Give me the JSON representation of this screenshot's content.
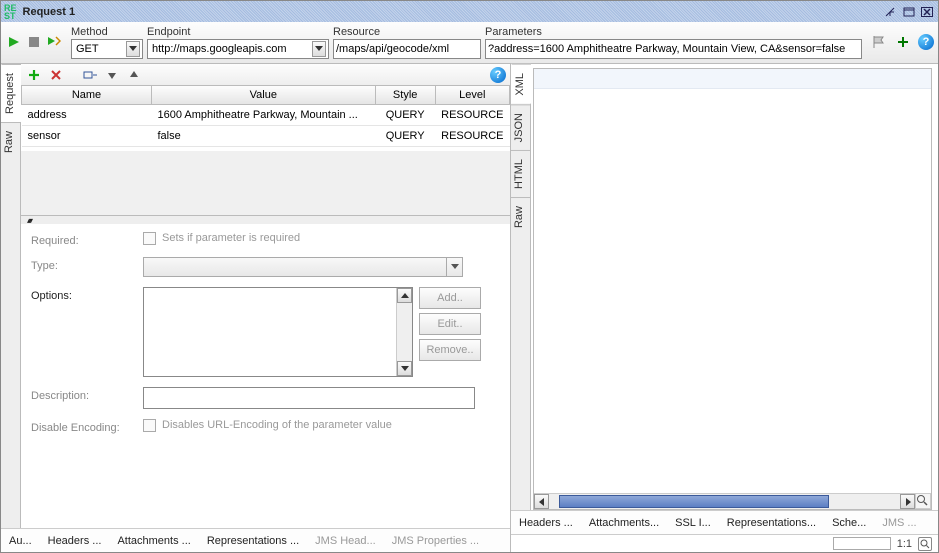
{
  "window": {
    "title": "Request 1"
  },
  "toolbar": {
    "method_label": "Method",
    "method_value": "GET",
    "endpoint_label": "Endpoint",
    "endpoint_value": "http://maps.googleapis.com",
    "resource_label": "Resource",
    "resource_value": "/maps/api/geocode/xml",
    "parameters_label": "Parameters",
    "parameters_value": "?address=1600 Amphitheatre Parkway, Mountain View, CA&sensor=false"
  },
  "left_tabs": {
    "raw": "Raw",
    "request": "Request"
  },
  "params": {
    "headers": {
      "name": "Name",
      "value": "Value",
      "style": "Style",
      "level": "Level"
    },
    "rows": [
      {
        "name": "address",
        "value": "1600 Amphitheatre Parkway, Mountain ...",
        "style": "QUERY",
        "level": "RESOURCE"
      },
      {
        "name": "sensor",
        "value": "false",
        "style": "QUERY",
        "level": "RESOURCE"
      }
    ]
  },
  "form": {
    "required_label": "Required:",
    "required_hint": "Sets if parameter is required",
    "type_label": "Type:",
    "options_label": "Options:",
    "btn_add": "Add..",
    "btn_edit": "Edit..",
    "btn_remove": "Remove..",
    "description_label": "Description:",
    "disable_enc_label": "Disable Encoding:",
    "disable_enc_hint": "Disables URL-Encoding of the parameter value"
  },
  "left_bottom_tabs": {
    "au": "Au...",
    "headers": "Headers ...",
    "attachments": "Attachments ...",
    "representations": "Representations ...",
    "jms_head": "JMS Head...",
    "jms_props": "JMS Properties ..."
  },
  "right_tabs": {
    "raw": "Raw",
    "html": "HTML",
    "json": "JSON",
    "xml": "XML"
  },
  "right_bottom_tabs": {
    "headers": "Headers ...",
    "attachments": "Attachments...",
    "ssl": "SSL I...",
    "representations": "Representations...",
    "sche": "Sche...",
    "jms": "JMS ..."
  },
  "status": {
    "ratio": "1:1"
  }
}
